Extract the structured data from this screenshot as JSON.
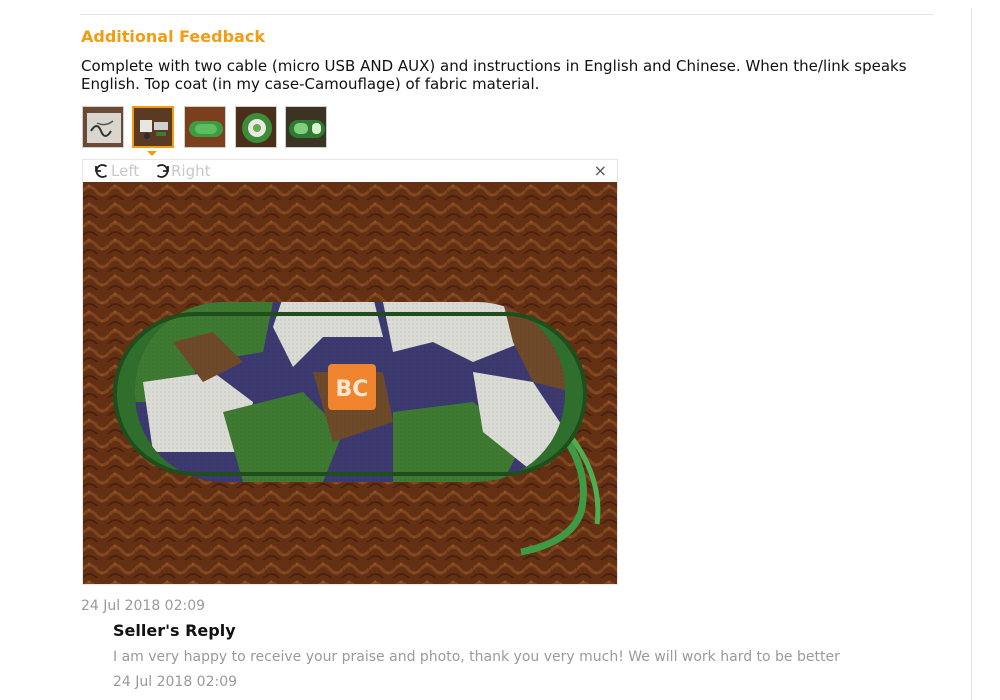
{
  "feedback": {
    "section_title": "Additional Feedback",
    "text": "Complete with two cable (micro USB AND AUX) and instructions in English and Chinese. When the/link speaks English. Top coat (in my case-Camouflage) of fabric material.",
    "date": "24 Jul 2018 02:09",
    "thumbnails": [
      {
        "icon": "cables-photo-thumbnail",
        "active": false
      },
      {
        "icon": "accessories-photo-thumbnail",
        "active": true
      },
      {
        "icon": "speaker-side-photo-thumbnail",
        "active": false
      },
      {
        "icon": "speaker-end-photo-thumbnail",
        "active": false
      },
      {
        "icon": "speaker-lit-photo-thumbnail",
        "active": false
      }
    ]
  },
  "viewer": {
    "rotate_left_label": "Left",
    "rotate_right_label": "Right",
    "close_glyph": "×",
    "photo_subject": "camouflage-fabric-speaker-photo"
  },
  "seller_reply": {
    "title": "Seller's Reply",
    "text": "I am very happy to receive your praise and photo, thank you very much! We will work hard to be better",
    "date": "24 Jul 2018 02:09"
  },
  "colors": {
    "accent": "#f39c12",
    "muted_text": "#9a9a9a",
    "divider": "#e3e3e3",
    "camo_green": "#3f7a32",
    "camo_navy": "#3c3a70",
    "camo_brown": "#6f4a2a",
    "camo_white": "#dcdcd6",
    "logo_orange": "#f0842f",
    "rug_brown": "#7b3f1d"
  }
}
